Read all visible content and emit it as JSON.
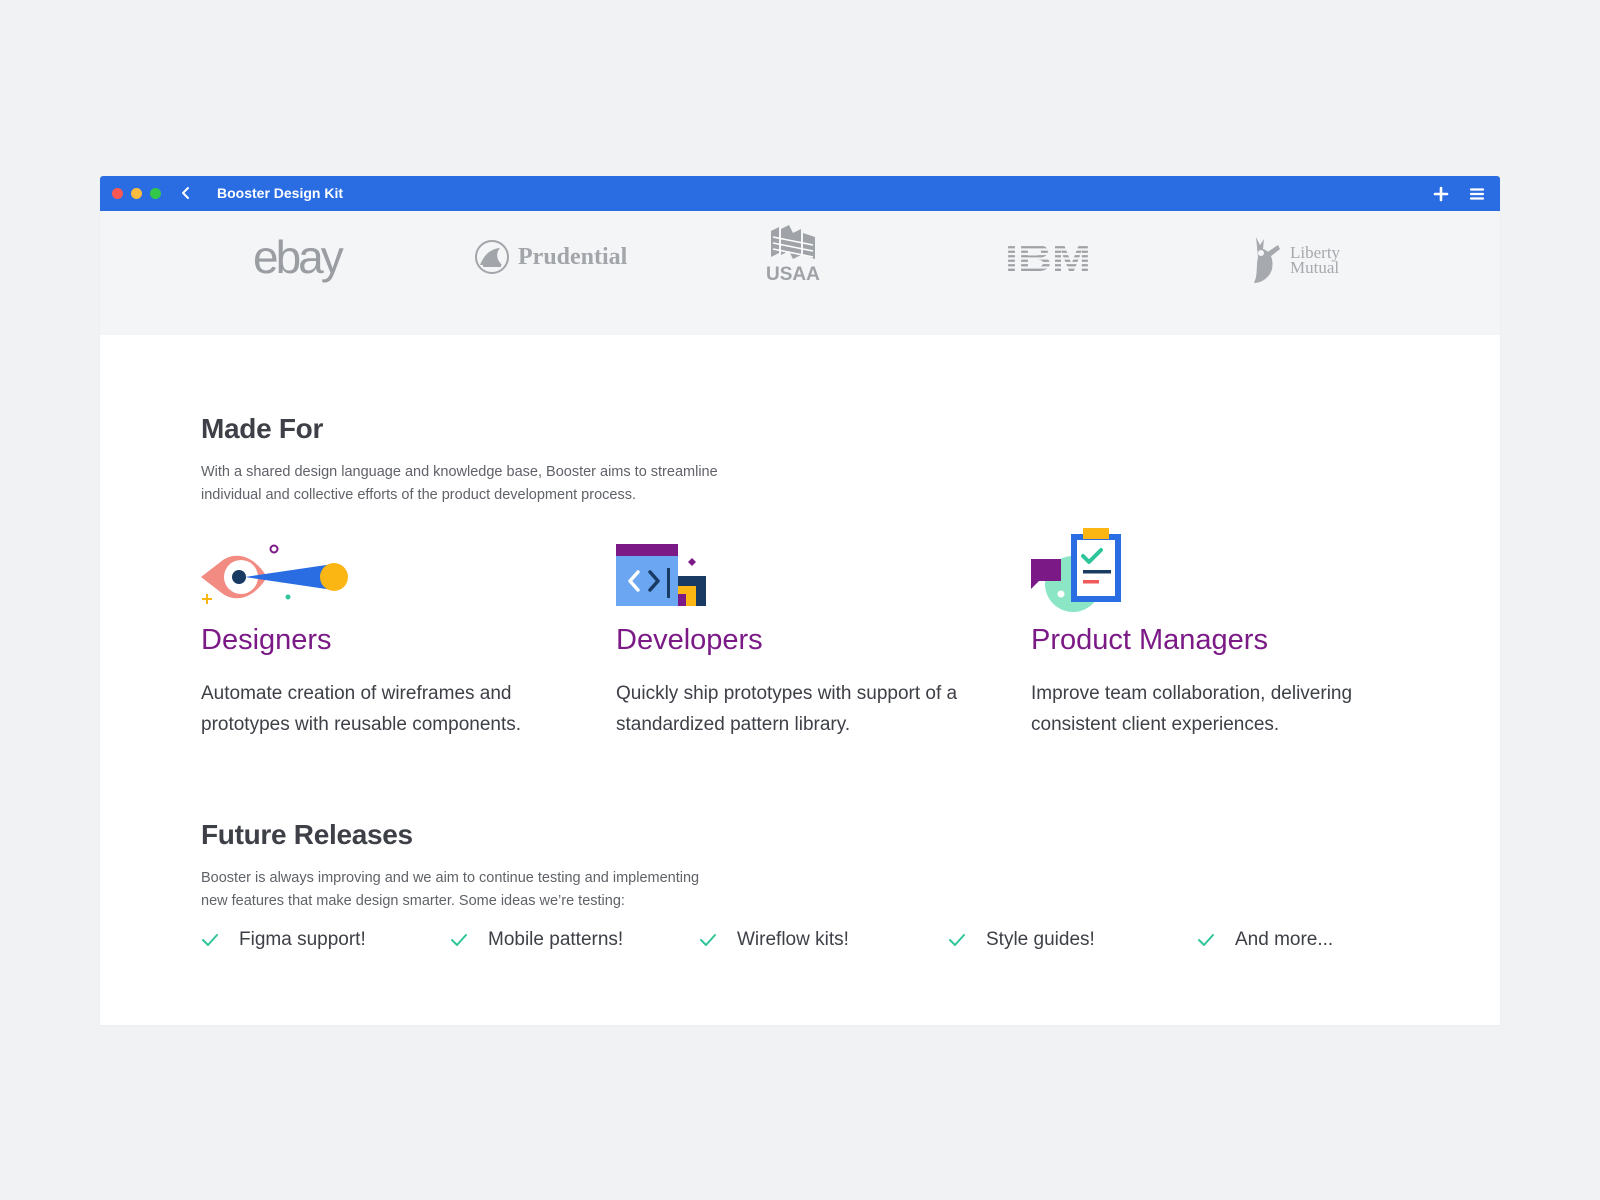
{
  "window": {
    "title": "Booster Design Kit",
    "accent_color": "#2a6de3",
    "controls": [
      "close-dot",
      "minimize-dot",
      "zoom-dot"
    ],
    "toolbar_icons": [
      "back-chevron-icon",
      "plus-icon",
      "hamburger-menu-icon"
    ]
  },
  "logos": {
    "ebay": "ebay",
    "prudential": "Prudential",
    "usaa": "USAA",
    "ibm": "IBM",
    "liberty_line1": "Liberty",
    "liberty_line2": "Mutual"
  },
  "made_for": {
    "heading": "Made For",
    "lead_line1": "With a shared design language and knowledge base, Booster aims to streamline",
    "lead_line2": "individual and collective efforts of the product development process.",
    "cards": [
      {
        "title": "Designers",
        "line1": "Automate creation of wireframes and",
        "line2": "prototypes with reusable components.",
        "icon": "eye-telescope-icon"
      },
      {
        "title": "Developers",
        "line1": "Quickly ship prototypes with support of a",
        "line2": "standardized pattern library.",
        "icon": "code-window-icon"
      },
      {
        "title": "Product Managers",
        "line1": "Improve team collaboration, delivering",
        "line2": "consistent client experiences.",
        "icon": "clipboard-checklist-icon"
      }
    ],
    "title_color": "#7b1a86"
  },
  "future_releases": {
    "heading": "Future Releases",
    "lead_line1": "Booster is always improving and we aim to continue testing and implementing",
    "lead_line2": "new features that make design smarter. Some ideas we’re testing:",
    "items": [
      "Figma support!",
      "Mobile patterns!",
      "Wireflow kits!",
      "Style guides!",
      "And more..."
    ],
    "check_color": "#2fc59a"
  }
}
